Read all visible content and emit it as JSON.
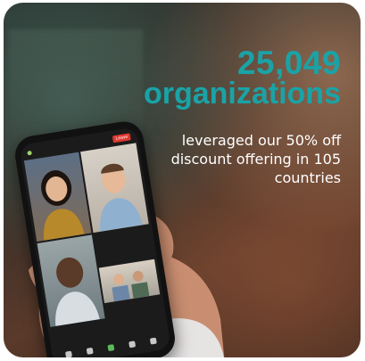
{
  "stat": {
    "number": "25,049",
    "unit": "organizations",
    "description": "leveraged our 50% off discount offering in 105 countries"
  },
  "colors": {
    "accent": "#1aa3a7",
    "text": "#ffffff"
  },
  "phone": {
    "leave_button": "Leave"
  }
}
